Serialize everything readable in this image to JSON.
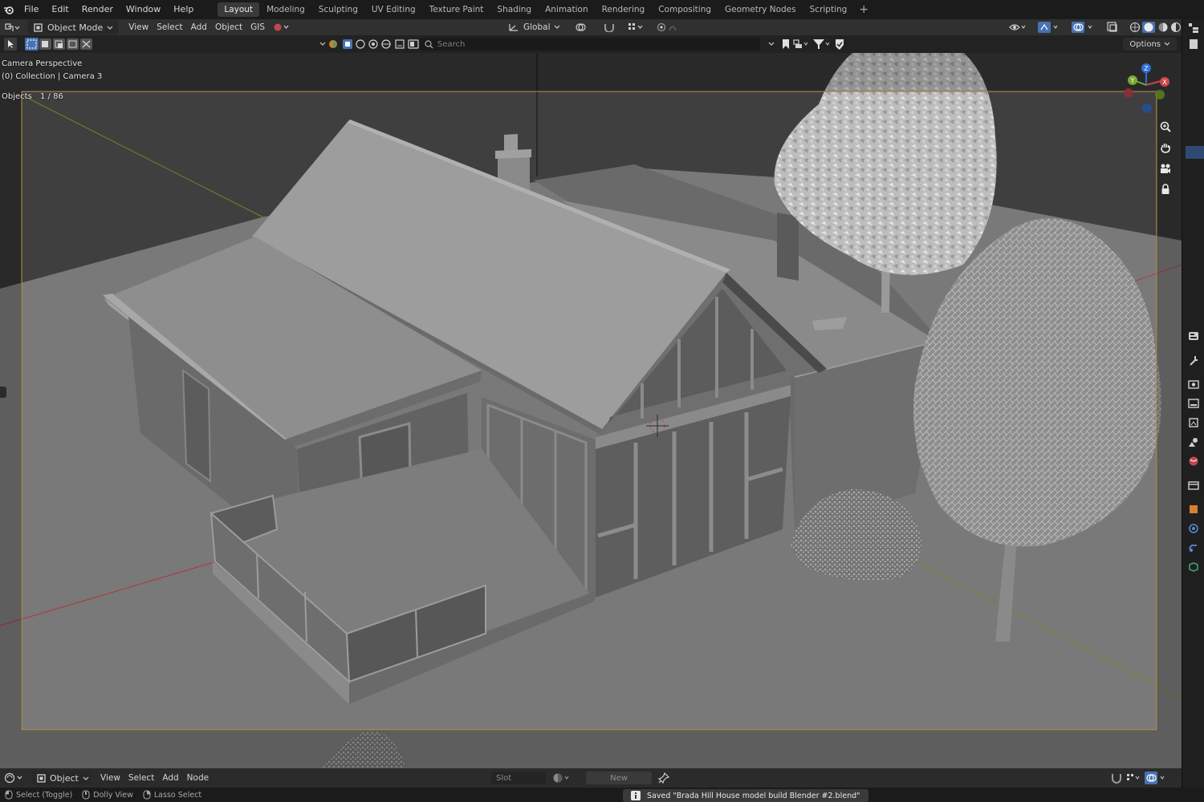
{
  "topbar": {
    "menu": [
      "File",
      "Edit",
      "Render",
      "Window",
      "Help"
    ],
    "workspaces": [
      "Layout",
      "Modeling",
      "Sculpting",
      "UV Editing",
      "Texture Paint",
      "Shading",
      "Animation",
      "Rendering",
      "Compositing",
      "Geometry Nodes",
      "Scripting"
    ],
    "active_workspace": "Layout",
    "add_label": "+"
  },
  "header": {
    "mode": "Object Mode",
    "menus": [
      "View",
      "Select",
      "Add",
      "Object",
      "GIS"
    ],
    "orientation": "Global"
  },
  "toolrow": {
    "search_placeholder": "Search",
    "options_label": "Options"
  },
  "viewport": {
    "view_name": "Camera Perspective",
    "collection_line": "(0) Collection | Camera 3",
    "objects_label": "Objects",
    "objects_count": "1 / 86",
    "gizmo": {
      "z": "Z",
      "y": "Y",
      "x": "X"
    },
    "colors": {
      "background": "#393939",
      "ground": "#777777",
      "camera_frame": "#b8924a",
      "axis_x": "#b0353a",
      "axis_y": "#6a8a2a"
    }
  },
  "bottombar": {
    "editor_mode": "Object",
    "menus": [
      "View",
      "Select",
      "Add",
      "Node"
    ],
    "slot_label": "Slot",
    "new_label": "New"
  },
  "status": {
    "items": [
      "Select (Toggle)",
      "Dolly View",
      "Lasso Select"
    ],
    "toast": "Saved \"Brada Hill House model build Blender #2.blend\""
  }
}
